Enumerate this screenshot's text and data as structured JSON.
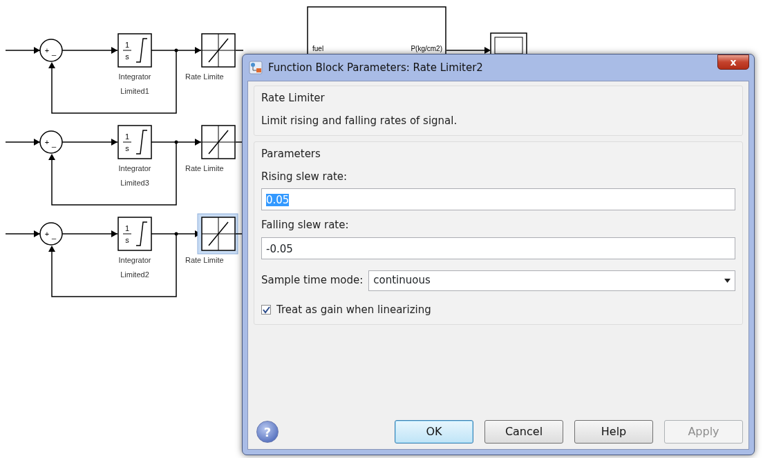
{
  "diagram": {
    "rows": [
      {
        "integrator_label": "Integrator",
        "integrator_sublabel": "Limited1",
        "integrator_num": "1",
        "integrator_den": "s",
        "limiter_label": "Rate Limite",
        "selected": false
      },
      {
        "integrator_label": "Integrator",
        "integrator_sublabel": "Limited3",
        "integrator_num": "1",
        "integrator_den": "s",
        "limiter_label": "Rate Limite",
        "selected": false
      },
      {
        "integrator_label": "Integrator",
        "integrator_sublabel": "Limited2",
        "integrator_num": "1",
        "integrator_den": "s",
        "limiter_label": "Rate Limite",
        "selected": true
      }
    ],
    "sum_signs": [
      "+",
      "_"
    ],
    "subsystem": {
      "input_port": "fuel",
      "output_port": "P(kg/cm2)"
    }
  },
  "dialog": {
    "title": "Function Block Parameters: Rate Limiter2",
    "close": "x",
    "description_group": {
      "title": "Rate Limiter",
      "text": "Limit rising and falling rates of signal."
    },
    "parameters_group": {
      "title": "Parameters",
      "items": [
        {
          "kind": "text",
          "label": "Rising slew rate:",
          "value": "0.05",
          "highlighted": true
        },
        {
          "kind": "text",
          "label": "Falling slew rate:",
          "value": "-0.05",
          "highlighted": false
        },
        {
          "kind": "select",
          "label": "Sample time mode:",
          "value": "continuous"
        },
        {
          "kind": "checkbox",
          "label": "Treat as gain when linearizing",
          "checked": true
        }
      ]
    },
    "help": "?",
    "buttons": [
      {
        "label": "OK",
        "default": true,
        "disabled": false
      },
      {
        "label": "Cancel",
        "default": false,
        "disabled": false
      },
      {
        "label": "Help",
        "default": false,
        "disabled": false
      },
      {
        "label": "Apply",
        "default": false,
        "disabled": true
      }
    ]
  }
}
